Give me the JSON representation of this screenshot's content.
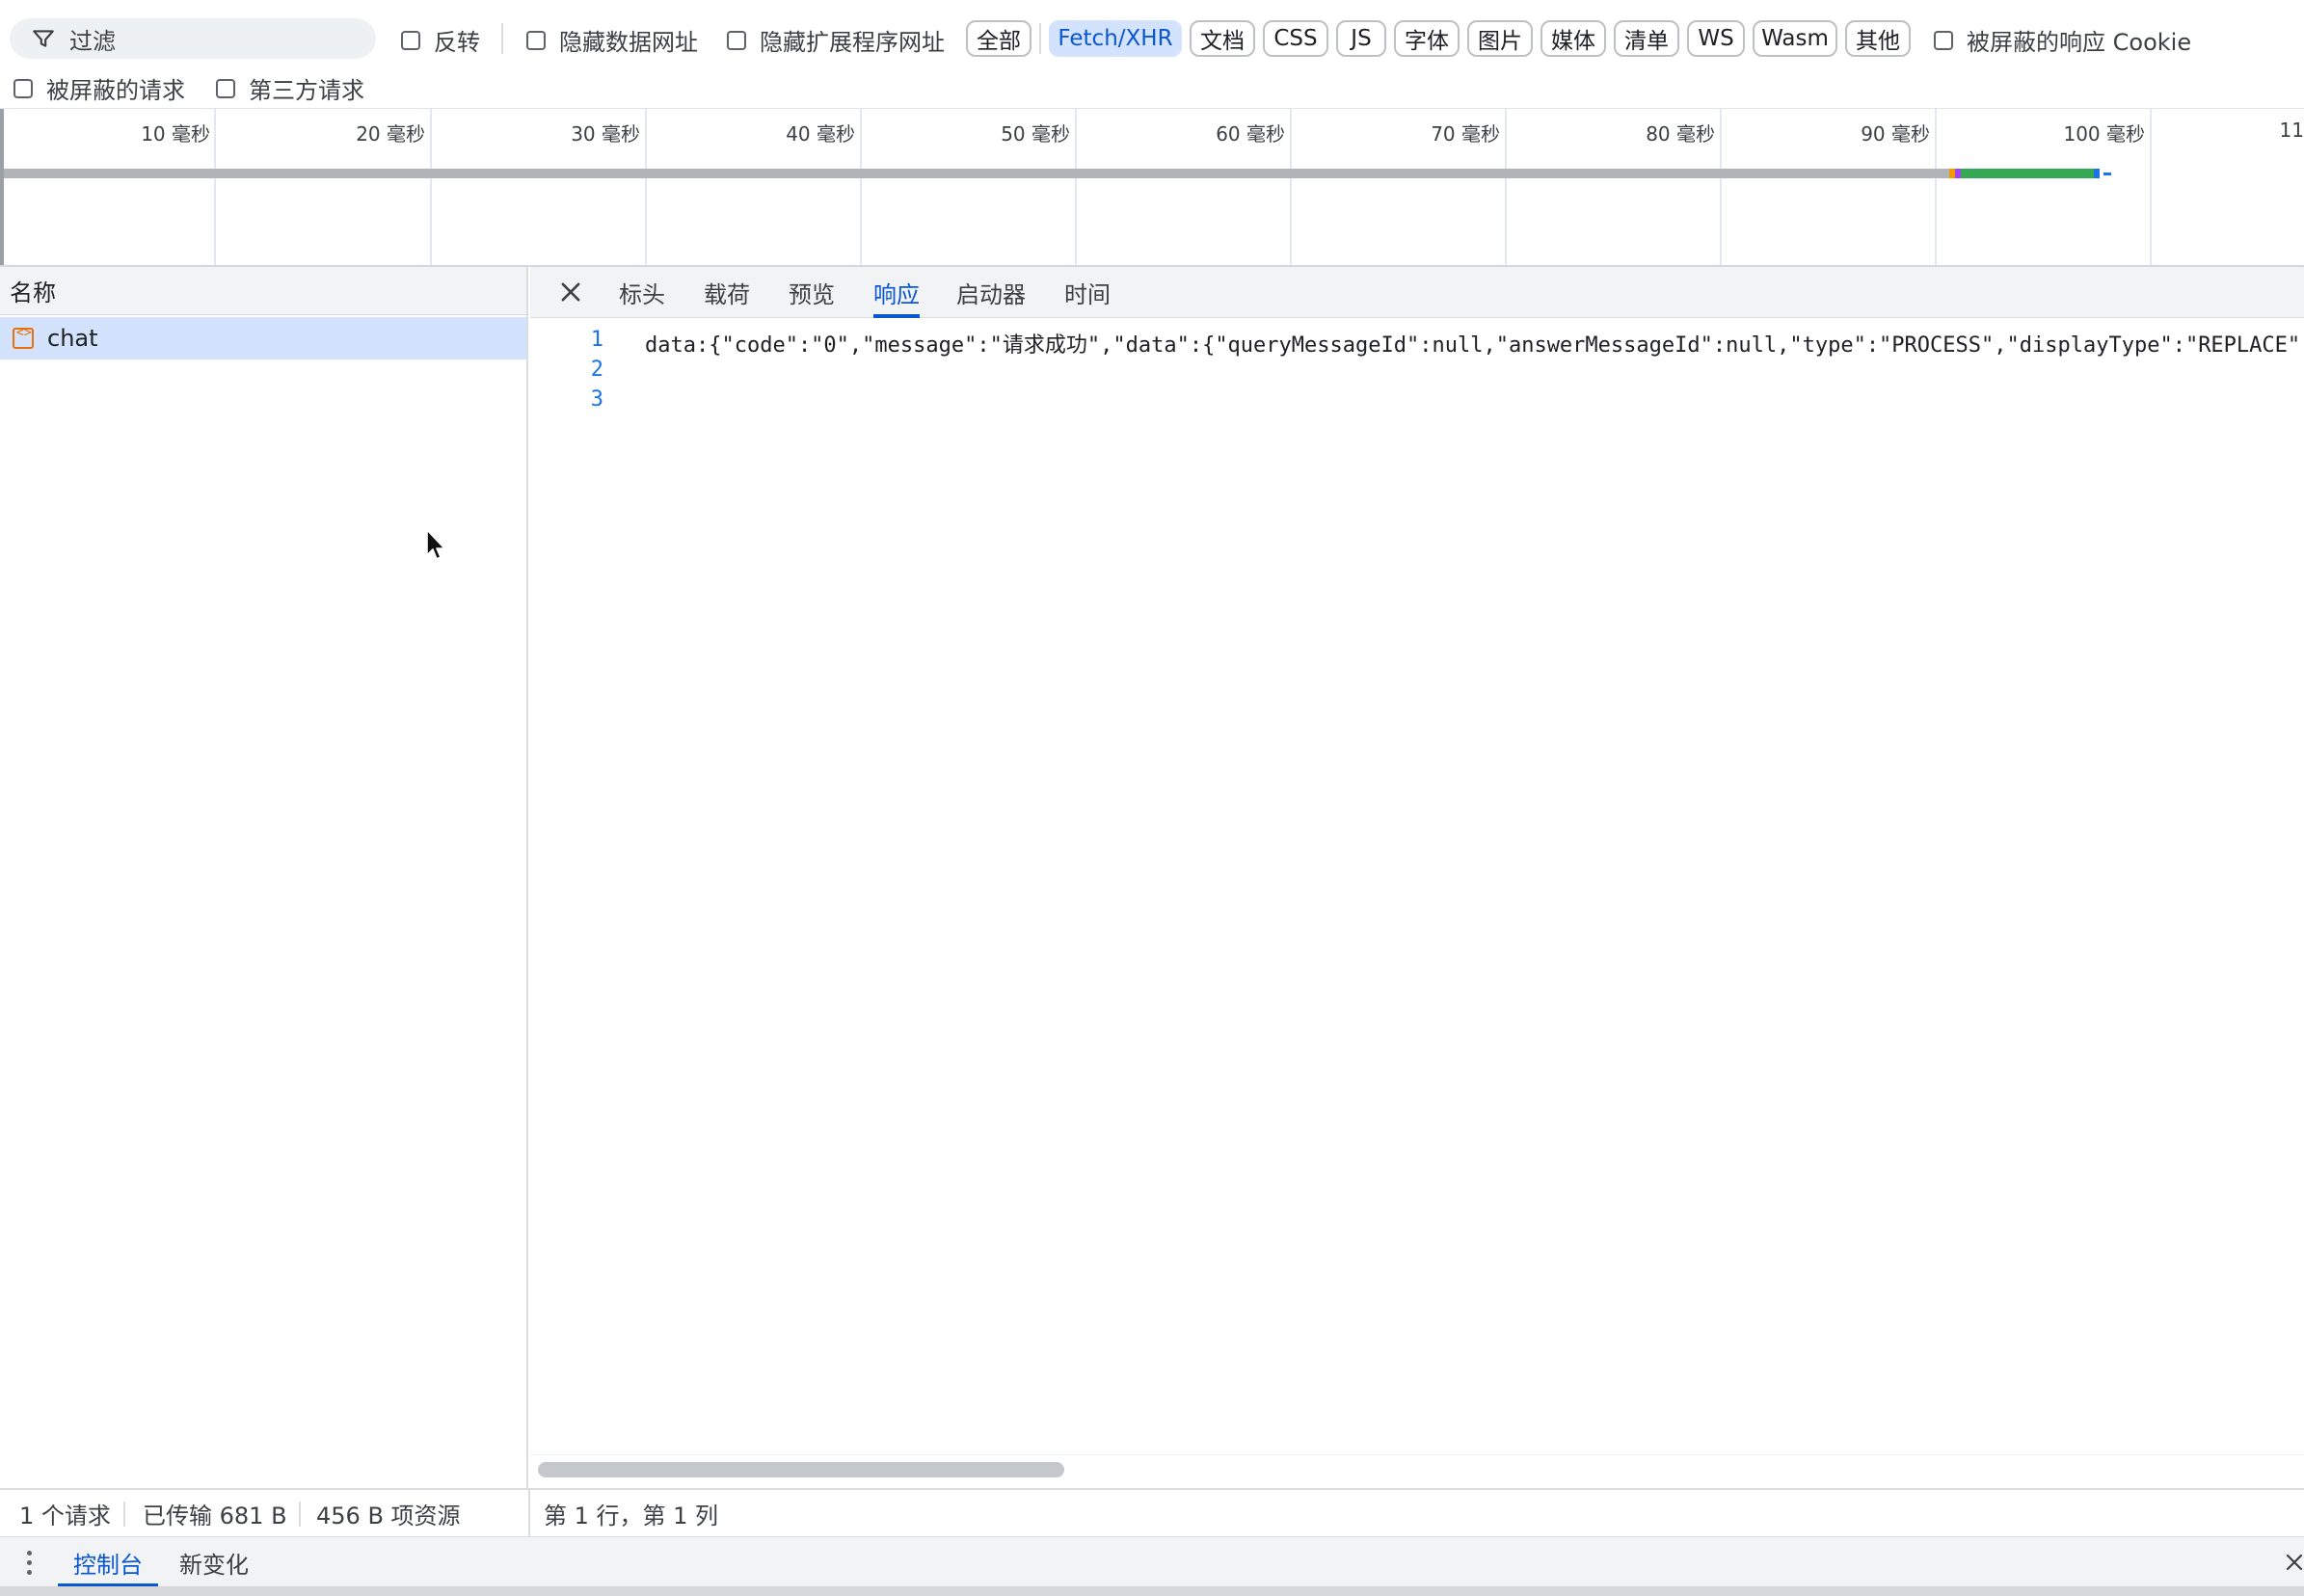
{
  "filter": {
    "placeholder": "过滤",
    "invert_label": "反转",
    "hide_data_urls_label": "隐藏数据网址",
    "hide_ext_urls_label": "隐藏扩展程序网址",
    "blocked_cookies_label": "被屏蔽的响应 Cookie",
    "blocked_requests_label": "被屏蔽的请求",
    "third_party_label": "第三方请求",
    "type_chips": [
      {
        "label": "全部",
        "active": false
      },
      {
        "label": "Fetch/XHR",
        "active": true
      },
      {
        "label": "文档",
        "active": false
      },
      {
        "label": "CSS",
        "active": false
      },
      {
        "label": "JS",
        "active": false
      },
      {
        "label": "字体",
        "active": false
      },
      {
        "label": "图片",
        "active": false
      },
      {
        "label": "媒体",
        "active": false
      },
      {
        "label": "清单",
        "active": false
      },
      {
        "label": "WS",
        "active": false
      },
      {
        "label": "Wasm",
        "active": false
      },
      {
        "label": "其他",
        "active": false
      }
    ]
  },
  "timeline": {
    "ticks": [
      "10 毫秒",
      "20 毫秒",
      "30 毫秒",
      "40 毫秒",
      "50 毫秒",
      "60 毫秒",
      "70 毫秒",
      "80 毫秒",
      "90 毫秒",
      "100 毫秒",
      "11"
    ],
    "colors": {
      "waiting": "#b0b3b8",
      "download": "#34a853",
      "queued": "#f29900",
      "edge": "#1a73e8"
    }
  },
  "requests": {
    "column_header": "名称",
    "items": [
      {
        "name": "chat",
        "selected": true
      }
    ]
  },
  "detail": {
    "tabs": [
      {
        "label": "标头",
        "active": false
      },
      {
        "label": "载荷",
        "active": false
      },
      {
        "label": "预览",
        "active": false
      },
      {
        "label": "响应",
        "active": true
      },
      {
        "label": "启动器",
        "active": false
      },
      {
        "label": "时间",
        "active": false
      }
    ],
    "line_numbers": [
      "1",
      "2",
      "3"
    ],
    "response_line_1": "data:{\"code\":\"0\",\"message\":\"请求成功\",\"data\":{\"queryMessageId\":null,\"answerMessageId\":null,\"type\":\"PROCESS\",\"displayType\":\"REPLACE\""
  },
  "status": {
    "request_count": "1 个请求",
    "transferred": "已传输 681 B",
    "resources": "456 B 项资源",
    "cursor_position": "第 1 行，第 1 列"
  },
  "drawer": {
    "tabs": [
      {
        "label": "控制台",
        "active": true
      },
      {
        "label": "新变化",
        "active": false
      }
    ]
  },
  "accent_color": "#0b57d0"
}
